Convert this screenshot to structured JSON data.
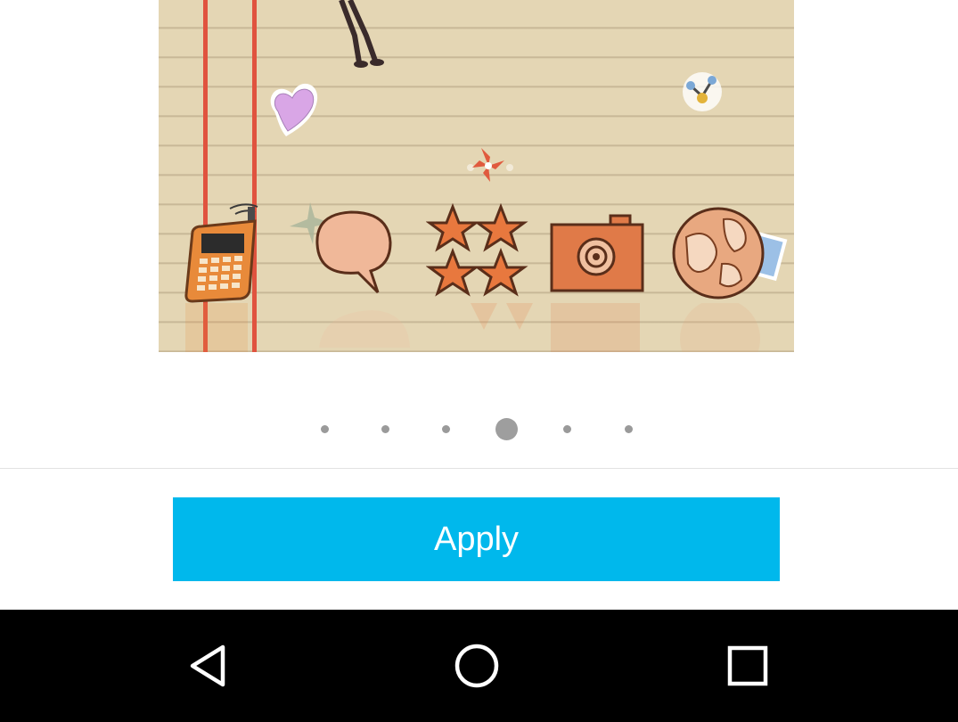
{
  "preview": {
    "icons": [
      "phone-icon",
      "speech-bubble-icon",
      "stars-icon",
      "camera-icon",
      "globe-icon"
    ],
    "stickers": [
      "heart-icon",
      "share-icon",
      "pinwheel-icon"
    ]
  },
  "pager": {
    "count": 6,
    "active_index": 3
  },
  "apply_label": "Apply",
  "colors": {
    "accent": "#00b8ec",
    "navbar": "#000000"
  },
  "navbar": {
    "icons": [
      "back-icon",
      "home-icon",
      "recents-icon"
    ]
  }
}
